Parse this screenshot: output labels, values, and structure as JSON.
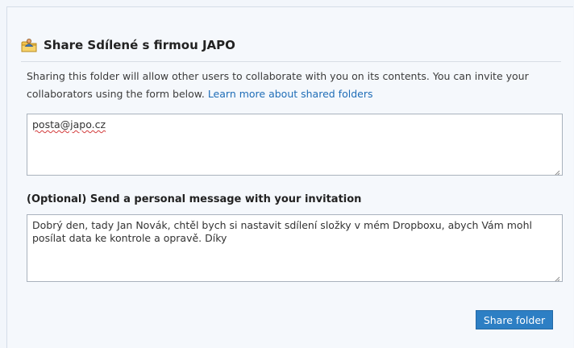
{
  "dialog": {
    "title": "Share Sdílené s firmou JAPO",
    "description": "Sharing this folder will allow other users to collaborate with you on its contents. You can invite your collaborators using the form below.",
    "learn_more_link": "Learn more about shared folders",
    "email_value": "posta@japo.cz",
    "optional_label": "(Optional) Send a personal message with your invitation",
    "message_value": "Dobrý den, tady Jan Novák, chtěl bych si nastavit sdílení složky v mém Dropboxu, abych Vám mohl posílat data ke kontrole a opravě. Díky",
    "share_button_label": "Share folder"
  },
  "icons": {
    "title_icon": "shared-folder-icon",
    "resize_grip": "resize-grip-icon"
  },
  "colors": {
    "accent": "#2d7fc4",
    "link": "#1f6db7",
    "background": "#f5f8fc",
    "spellcheck": "#d23b3b"
  }
}
